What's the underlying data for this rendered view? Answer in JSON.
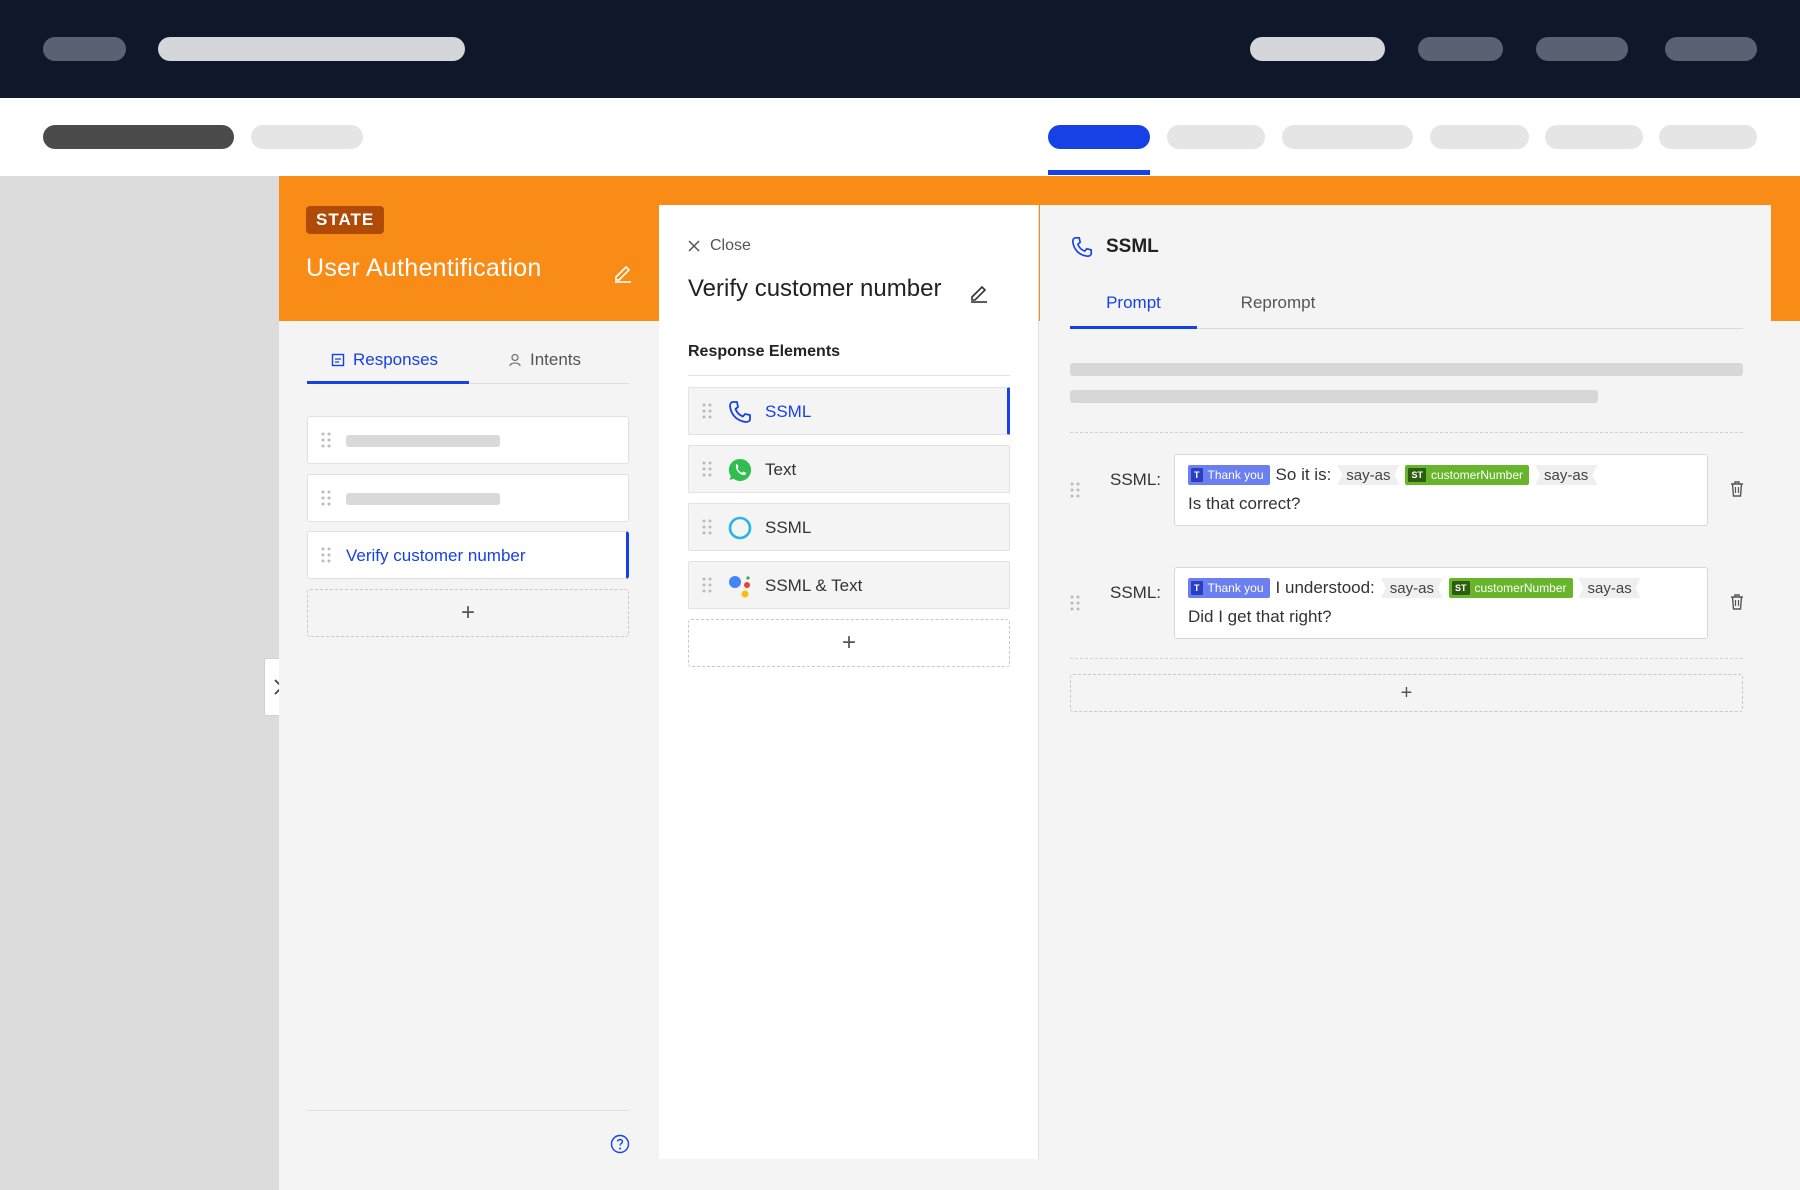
{
  "state": {
    "badge": "STATE",
    "title": "User Authentification"
  },
  "left_panel": {
    "tabs": [
      {
        "label": "Responses",
        "icon": "responses-icon",
        "active": true
      },
      {
        "label": "Intents",
        "icon": "person-icon",
        "active": false
      }
    ],
    "items": [
      {
        "label": "",
        "placeholder": true
      },
      {
        "label": "",
        "placeholder": true
      },
      {
        "label": "Verify customer number",
        "selected": true
      }
    ],
    "add_symbol": "+"
  },
  "middle_panel": {
    "close_label": "Close",
    "title": "Verify customer number",
    "section_label": "Response Elements",
    "elements": [
      {
        "label": "SSML",
        "icon": "phone-icon",
        "selected": true
      },
      {
        "label": "Text",
        "icon": "whatsapp-icon",
        "selected": false
      },
      {
        "label": "SSML",
        "icon": "alexa-icon",
        "selected": false
      },
      {
        "label": "SSML & Text",
        "icon": "google-assistant-icon",
        "selected": false
      }
    ],
    "add_symbol": "+"
  },
  "right_panel": {
    "title": "SSML",
    "title_icon": "phone-icon",
    "tabs": [
      {
        "label": "Prompt",
        "active": true
      },
      {
        "label": "Reprompt",
        "active": false
      }
    ],
    "rows": [
      {
        "label": "SSML:",
        "chip_text_tag": "T",
        "chip_text": "Thank you",
        "text_a": "So it is:",
        "sayas_1": "say-as",
        "chip_var_tag": "ST",
        "chip_var": "customerNumber",
        "sayas_2": "say-as",
        "line2": "Is that correct?"
      },
      {
        "label": "SSML:",
        "chip_text_tag": "T",
        "chip_text": "Thank you",
        "text_a": "I understood:",
        "sayas_1": "say-as",
        "chip_var_tag": "ST",
        "chip_var": "customerNumber",
        "sayas_2": "say-as",
        "line2": "Did I get that right?"
      }
    ],
    "add_symbol": "+"
  },
  "colors": {
    "accent": "#1641e6",
    "state_band": "#f98c17",
    "state_badge": "#b04b07",
    "topbar": "#0f172b",
    "text_chip": "#6b7ff0",
    "var_chip": "#67b52b"
  }
}
